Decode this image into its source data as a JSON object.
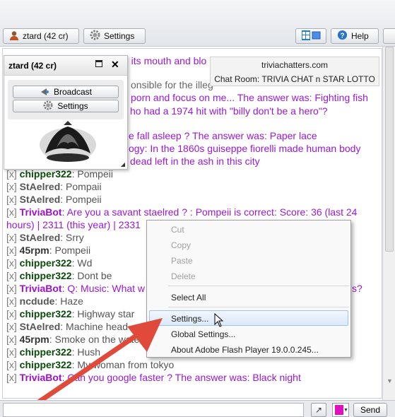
{
  "toolbar": {
    "user_label": "ztard (42 cr)",
    "settings_label": "Settings",
    "help_label": "Help"
  },
  "info": {
    "site": "triviachatters.com",
    "room": "Chat Room: TRIVIA  CHAT n STAR LOTTO"
  },
  "profile": {
    "title": "ztard (42 cr)",
    "broadcast_label": "Broadcast",
    "settings_label": "Settings"
  },
  "background_text": [
    "n its mouth and blo",
    "onsible for the illeg",
    "porn and focus on me... The answer was: Fighting fish",
    "ho had a 1974 hit with \"billy don't be a hero\"?",
    "e fall asleep ? The answer was: Paper lace",
    "ogy: In the 1860s guiseppe fiorelli made human body",
    "dead left in the ash in this city"
  ],
  "messages": [
    {
      "x": "[x]",
      "user": "chipper322",
      "text": ": Pompeii"
    },
    {
      "x": "[x]",
      "user": "StAelred",
      "text": ": Pompaii"
    },
    {
      "x": "[x]",
      "user": "StAelred",
      "text": ": Pompeii"
    },
    {
      "x": "[x]",
      "user": "TriviaBot",
      "text": ": Are you a savant staelred ? : Pompeii is correct: Score: 36 (last 24"
    },
    {
      "x": "",
      "user": "",
      "text": "hours) | 2311 (this year) | 2331"
    },
    {
      "x": "[x]",
      "user": "StAelred",
      "text": ": Srry"
    },
    {
      "x": "[x]",
      "user": "45rpm",
      "text": ": Pompeii"
    },
    {
      "x": "[x]",
      "user": "chipper322",
      "text": ": Wd"
    },
    {
      "x": "[x]",
      "user": "chipper322",
      "text": ": Dont be"
    },
    {
      "x": "[x]",
      "user": "TriviaBot",
      "text": ": Q: Music: What w"
    },
    {
      "x": "[x]",
      "user": "ncdude",
      "text": ": Haze"
    },
    {
      "x": "[x]",
      "user": "chipper322",
      "text": ": Highway star"
    },
    {
      "x": "[x]",
      "user": "StAelred",
      "text": ": Machine head"
    },
    {
      "x": "[x]",
      "user": "45rpm",
      "text": ": Smoke on the wate"
    },
    {
      "x": "[x]",
      "user": "chipper322",
      "text": ": Hush"
    },
    {
      "x": "[x]",
      "user": "chipper322",
      "text": ": My woman from tokyo"
    },
    {
      "x": "[x]",
      "user": "TriviaBot",
      "text": ": Can you google faster ? The answer was: Black night"
    }
  ],
  "msg_tail": "s?",
  "context_menu": {
    "cut": "Cut",
    "copy": "Copy",
    "paste": "Paste",
    "delete": "Delete",
    "select_all": "Select All",
    "settings": "Settings...",
    "global_settings": "Global Settings...",
    "about": "About Adobe Flash Player 19.0.0.245..."
  },
  "input": {
    "send_label": "Send",
    "color": "#e010c0"
  },
  "colors": {
    "triviabot": "#9a18d8",
    "arrow": "#e04a3a"
  }
}
